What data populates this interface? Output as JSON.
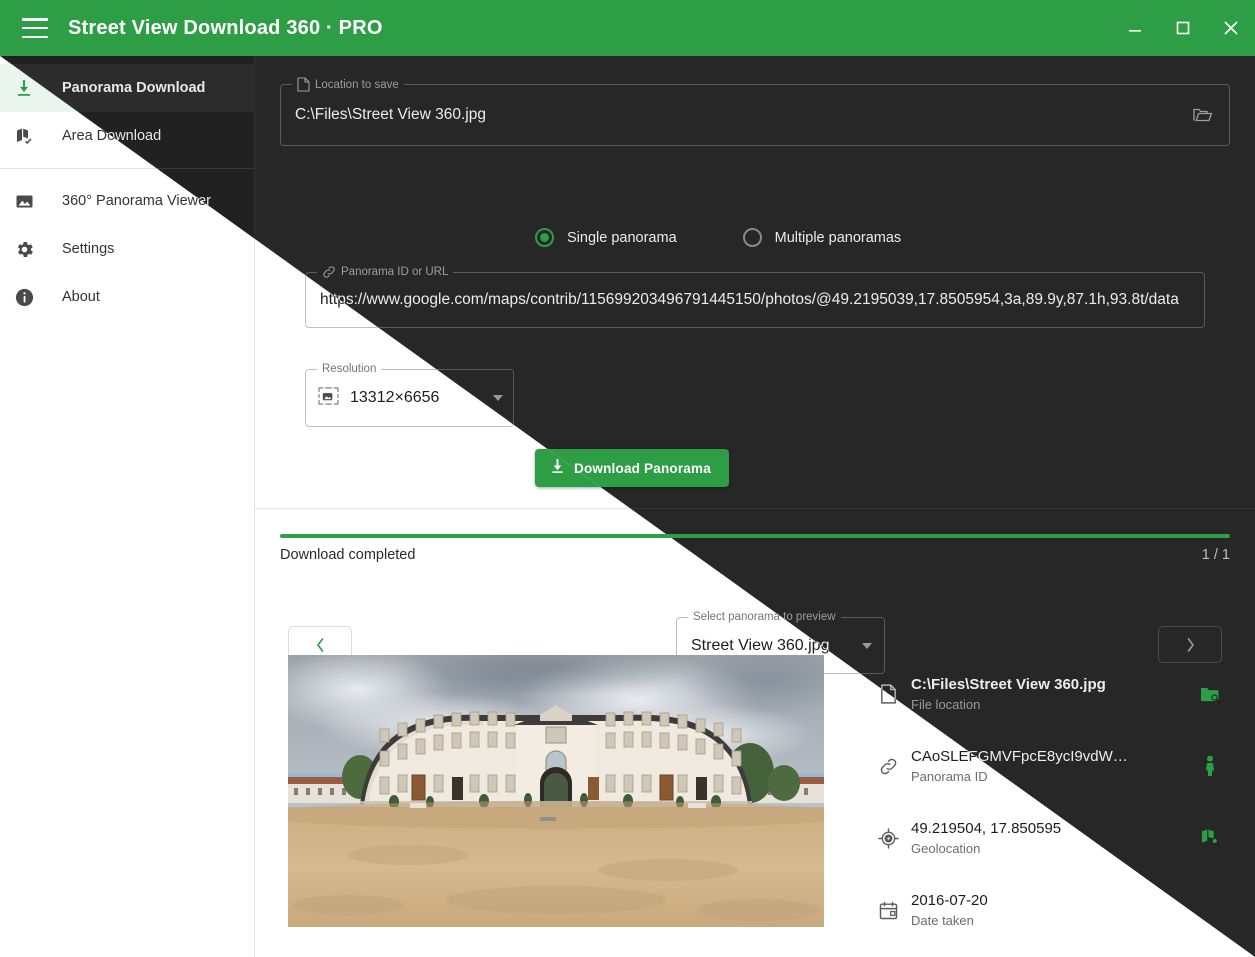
{
  "window": {
    "title": "Street View Download 360 · PRO",
    "accent_color": "#2e9e46",
    "menu_icon": "hamburger-icon",
    "controls": {
      "minimize": "minimize-icon",
      "maximize": "maximize-icon",
      "close": "close-icon"
    }
  },
  "sidebar": {
    "items": [
      {
        "label": "Panorama Download",
        "icon": "download-icon",
        "active": true
      },
      {
        "label": "Area Download",
        "icon": "map-check-icon",
        "active": false
      },
      {
        "label": "360° Panorama Viewer",
        "icon": "image-icon",
        "active": false
      },
      {
        "label": "Settings",
        "icon": "gear-icon",
        "active": false
      },
      {
        "label": "About",
        "icon": "info-icon",
        "active": false
      }
    ]
  },
  "main": {
    "location_field": {
      "legend": "Location to save",
      "legend_icon": "file-icon",
      "value": "C:\\Files\\Street View 360.jpg",
      "browse_icon": "folder-open-icon"
    },
    "mode": {
      "options": [
        {
          "label": "Single panorama",
          "selected": true
        },
        {
          "label": "Multiple panoramas",
          "selected": false
        }
      ]
    },
    "url_field": {
      "legend": "Panorama ID or URL",
      "legend_icon": "link-icon",
      "value": "https://www.google.com/maps/contrib/115699203496791445150/photos/@49.2195039,17.8505954,3a,89.9y,87.1h,93.8t/data"
    },
    "resolution": {
      "legend": "Resolution",
      "icon": "image-size-icon",
      "selected": "13312×6656",
      "caret_icon": "chevron-down-icon"
    },
    "download_button": {
      "label": "Download Panorama",
      "icon": "download-icon"
    }
  },
  "progress": {
    "status": "Download completed",
    "counter": "1 / 1",
    "percent": 100
  },
  "preview": {
    "prev_label": "‹",
    "next_label": "›",
    "select": {
      "legend": "Select panorama to preview",
      "value": "Street View 360.jpg",
      "caret_icon": "chevron-down-icon"
    }
  },
  "details": [
    {
      "icon": "file-icon",
      "value": "C:\\Files\\Street View 360.jpg",
      "sub": "File location",
      "action_icon": "folder-search-icon",
      "bold": true
    },
    {
      "icon": "link-icon",
      "value": "CAoSLEFGMVFpcE8ycI9vdW…",
      "sub": "Panorama ID",
      "action_icon": "pegman-icon",
      "bold": false
    },
    {
      "icon": "target-icon",
      "value": "49.219504, 17.850595",
      "sub": "Geolocation",
      "action_icon": "map-search-icon",
      "bold": false
    },
    {
      "icon": "calendar-icon",
      "value": "2016-07-20",
      "sub": "Date taken",
      "action_icon": "",
      "bold": false
    }
  ]
}
